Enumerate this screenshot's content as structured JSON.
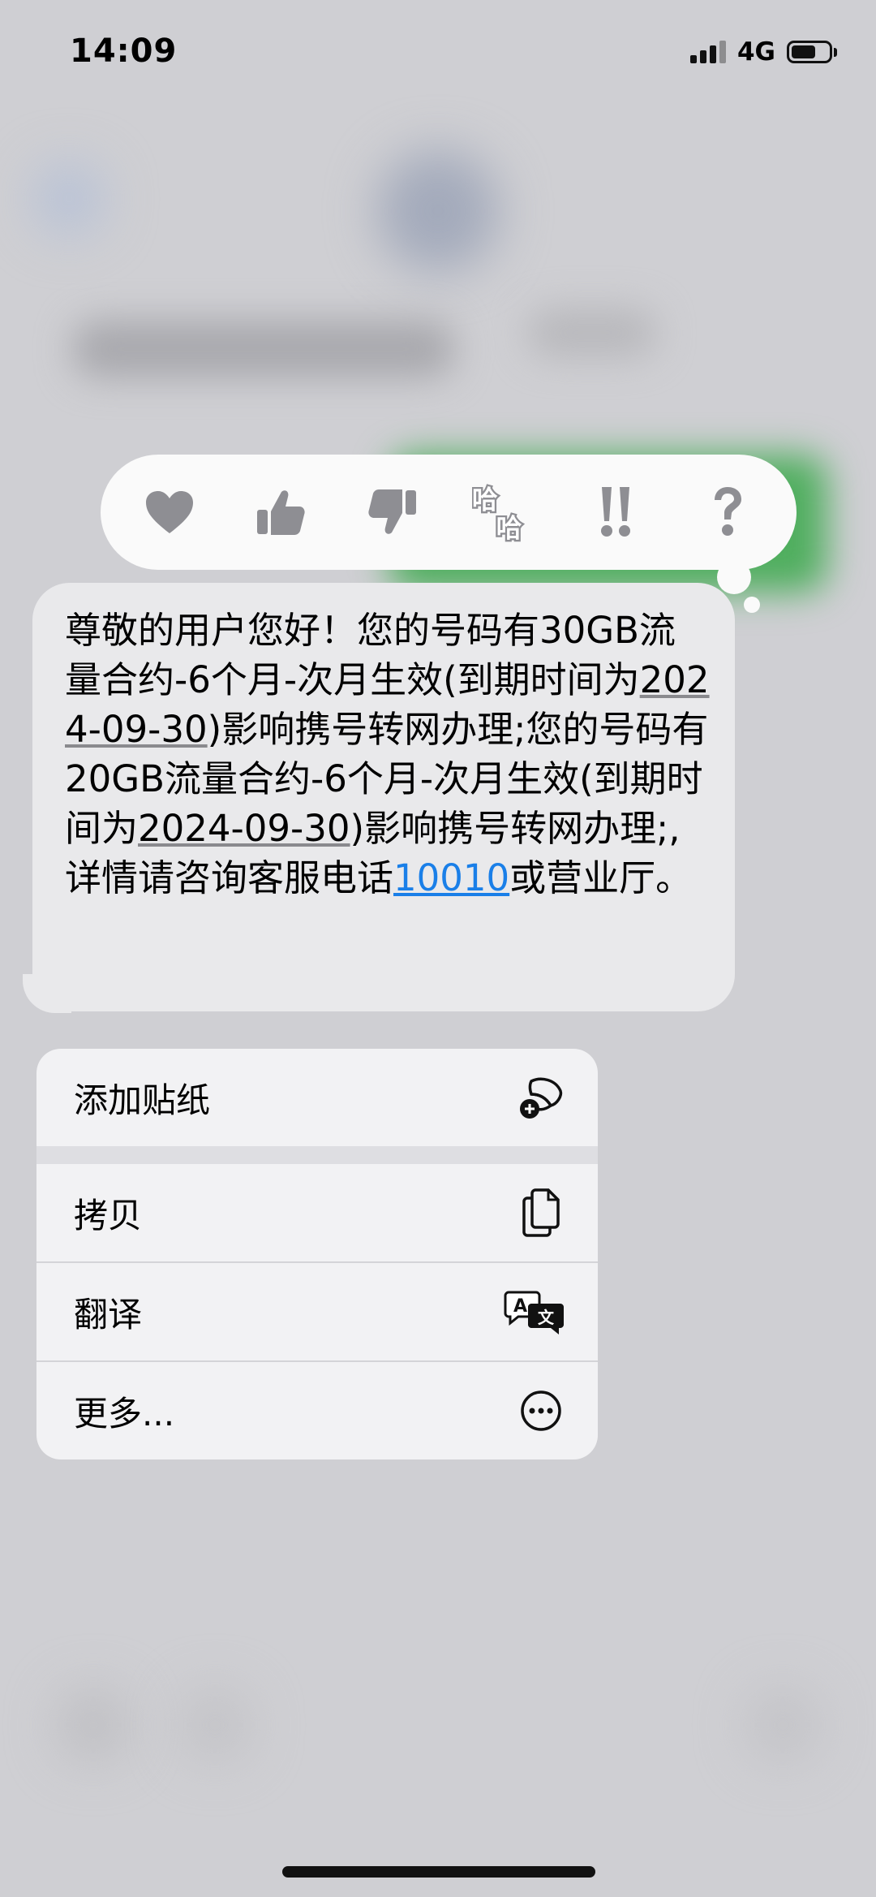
{
  "status_bar": {
    "time": "14:09",
    "network": "4G",
    "battery_level": 0.65
  },
  "tapback": {
    "reactions": [
      {
        "name": "heart-icon",
        "label": ""
      },
      {
        "name": "thumbs-up-icon",
        "label": ""
      },
      {
        "name": "thumbs-down-icon",
        "label": ""
      },
      {
        "name": "haha-icon",
        "label": "哈哈"
      },
      {
        "name": "exclamation-icon",
        "label": "!!"
      },
      {
        "name": "question-icon",
        "label": "?"
      }
    ]
  },
  "message": {
    "part1": "尊敬的用户您好！您的号码有30GB流量合约-6个月-次月生效(到期时间为",
    "date1": "2024-09-30",
    "part2": ")影响携号转网办理;您的号码有20GB流量合约-6个月-次月生效(到期时间为",
    "date2": "2024-09-30",
    "part3": ")影响携号转网办理;,详情请咨询客服电话",
    "phone": "10010",
    "part4": "或营业厅。"
  },
  "menu": {
    "add_sticker": "添加贴纸",
    "copy": "拷贝",
    "translate": "翻译",
    "more": "更多...",
    "translate_icon_glyphs": {
      "a": "A",
      "b": "文"
    }
  },
  "colors": {
    "background": "#cfcfd3",
    "bubble": "#e9e9eb",
    "link": "#1a7fe8",
    "sent_bubble_blur": "#4fae5e"
  }
}
